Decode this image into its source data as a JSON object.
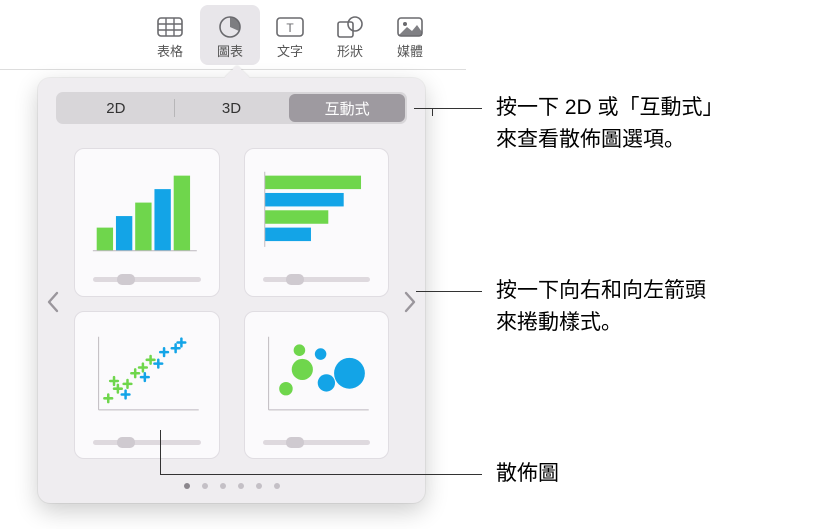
{
  "toolbar": {
    "items": [
      {
        "label": "表格",
        "icon": "table-icon"
      },
      {
        "label": "圖表",
        "icon": "chart-icon"
      },
      {
        "label": "文字",
        "icon": "text-icon"
      },
      {
        "label": "形狀",
        "icon": "shape-icon"
      },
      {
        "label": "媒體",
        "icon": "media-icon"
      }
    ],
    "active_index": 1
  },
  "popover": {
    "tabs": {
      "tab_2d": "2D",
      "tab_3d": "3D",
      "tab_interactive": "互動式",
      "selected": 2
    },
    "page_count": 6,
    "current_page": 0,
    "charts": [
      {
        "name": "interactive-column-chart"
      },
      {
        "name": "interactive-bar-chart"
      },
      {
        "name": "interactive-scatter-chart"
      },
      {
        "name": "interactive-bubble-chart"
      }
    ]
  },
  "callouts": {
    "tabs_line1": "按一下 2D 或「互動式」",
    "tabs_line2": "來查看散佈圖選項。",
    "arrows_line1": "按一下向右和向左箭頭",
    "arrows_line2": "來捲動樣式。",
    "scatter_label": "散佈圖"
  },
  "colors": {
    "green": "#6fd64c",
    "blue": "#13a4e7"
  }
}
